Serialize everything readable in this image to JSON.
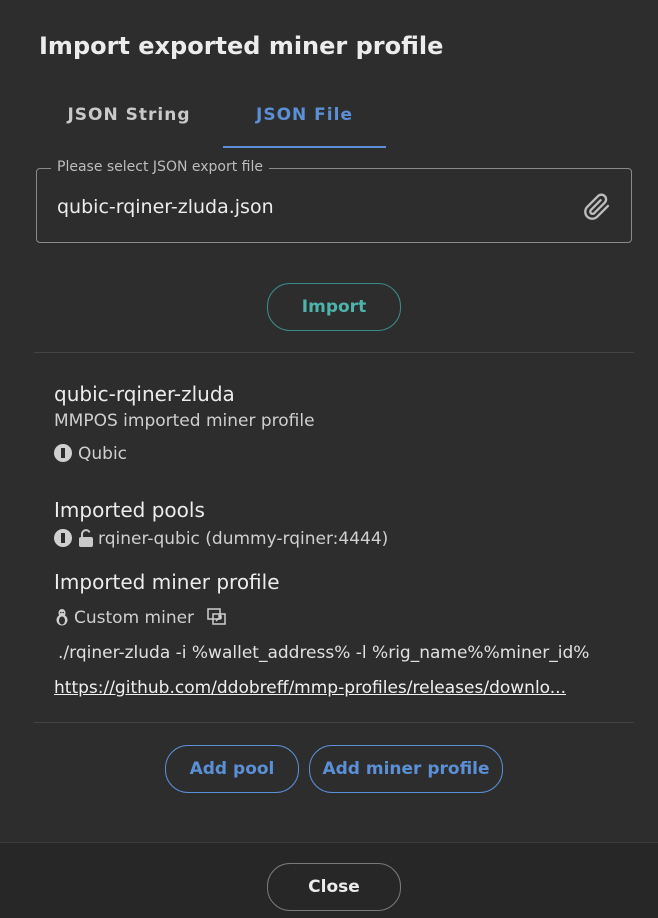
{
  "dialog": {
    "title": "Import exported miner profile"
  },
  "tabs": [
    {
      "label": "JSON String"
    },
    {
      "label": "JSON File",
      "active": true
    }
  ],
  "file_input": {
    "label": "Please select JSON export file",
    "value": "qubic-rqiner-zluda.json",
    "icon": "paperclip-icon"
  },
  "import_button": {
    "label": "Import"
  },
  "profile": {
    "name": "qubic-rqiner-zluda",
    "description": "MMPOS imported miner profile",
    "coin": "Qubic",
    "coin_icon": "qubic-icon"
  },
  "pools": {
    "heading": "Imported pools",
    "items": [
      {
        "label": "rqiner-qubic (dummy-rqiner:4444)",
        "icons": [
          "qubic-icon",
          "unlock-icon"
        ]
      }
    ]
  },
  "miner_profile": {
    "heading": "Imported miner profile",
    "miner": "Custom miner",
    "command": "./rqiner-zluda -i %wallet_address% -l %rig_name%%miner_id%",
    "url": "https://github.com/ddobreff/mmp-profiles/releases/downlo..."
  },
  "actions": {
    "add_pool": "Add pool",
    "add_miner_profile": "Add miner profile"
  },
  "footer": {
    "close": "Close"
  },
  "colors": {
    "accent": "#5b8fd6",
    "teal": "#4fb3ad",
    "background": "#2d2d2d"
  }
}
